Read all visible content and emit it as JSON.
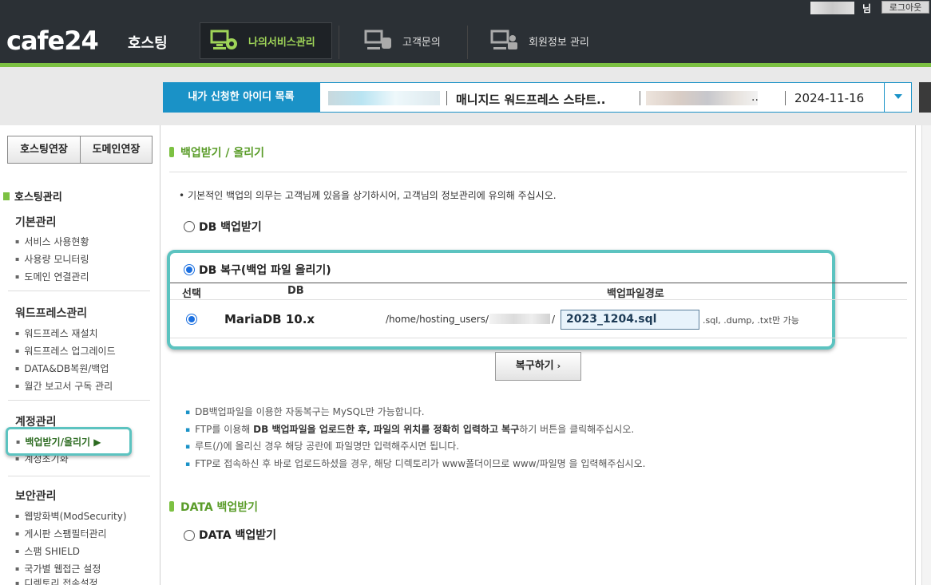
{
  "header": {
    "logo": "cafe24",
    "logo_sub": "호스팅",
    "user_suffix": "님",
    "logout": "로그아웃",
    "nav": [
      {
        "label": "나의서비스관리",
        "active": true
      },
      {
        "label": "고객문의",
        "active": false
      },
      {
        "label": "회원정보 관리",
        "active": false
      }
    ]
  },
  "idbar": {
    "label": "내가 신청한 아이디 목록",
    "plan": "매니지드 워드프레스 스타트..",
    "ellipsis": "..",
    "date": "2024-11-16"
  },
  "sidebar": {
    "btn_hosting_renew": "호스팅연장",
    "btn_domain_renew": "도메인연장",
    "section_title": "호스팅관리",
    "groups": [
      {
        "title": "기본관리",
        "items": [
          "서비스 사용현황",
          "사용량 모니터링",
          "도메인 연결관리"
        ]
      },
      {
        "title": "워드프레스관리",
        "items": [
          "워드프레스 재설치",
          "워드프레스 업그레이드",
          "DATA&DB복원/백업",
          "월간 보고서 구독 관리"
        ]
      },
      {
        "title": "계정관리",
        "items": [
          "백업받기/올리기 ▶",
          "계정초기화"
        ]
      },
      {
        "title": "보안관리",
        "items": [
          "웹방화벽(ModSecurity)",
          "게시판 스팸필터관리",
          "스팸 SHIELD",
          "국가별 웹접근 설정",
          "디렉토리 접속설정"
        ]
      }
    ]
  },
  "main": {
    "title": "백업받기 / 올리기",
    "notice": "기본적인 백업의 의무는 고객님께 있음을 상기하시어, 고객님의 정보관리에 유의해 주십시오.",
    "db_backup_label": "DB 백업받기",
    "db_restore_label": "DB 복구(백업 파일 올리기)",
    "table": {
      "headers": [
        "선택",
        "DB",
        "백업파일경로"
      ],
      "db_name": "MariaDB 10.x",
      "path_prefix": "/home/hosting_users/",
      "path_slash": "/",
      "file_value": "2023_1204.sql",
      "file_hint": ".sql, .dump, .txt만 가능"
    },
    "restore_button": "복구하기",
    "restore_button_arrow": "›",
    "tips": [
      {
        "pre": "DB백업파일을 이용한 자동복구는 MySQL만 가능합니다.",
        "bold": "",
        "post": ""
      },
      {
        "pre": "FTP를 이용해 ",
        "bold": "DB 백업파일을 업로드한 후, 파일의 위치를 정확히 입력하고 복구",
        "post": "하기 버튼을 클릭해주십시오."
      },
      {
        "pre": "루트(/)에 올리신 경우 해당 공란에 파일명만 입력해주시면 됩니다.",
        "bold": "",
        "post": ""
      },
      {
        "pre": "FTP로 접속하신 후 바로 업로드하셨을 경우, 해당 디렉토리가 www폴더이므로 www/파일명 을 입력해주십시오.",
        "bold": "",
        "post": ""
      }
    ],
    "data_title": "DATA 백업받기",
    "data_backup_label": "DATA 백업받기"
  },
  "colors": {
    "accent_green": "#7cc142",
    "accent_blue": "#1a92c7",
    "highlight_teal": "#5cc3c0"
  }
}
